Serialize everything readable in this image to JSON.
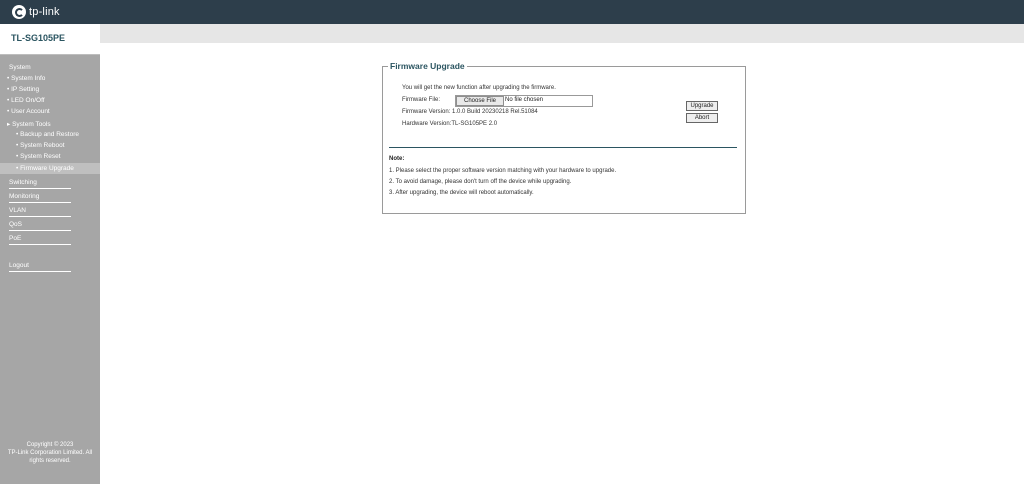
{
  "brand": {
    "logo_text": "tp-link"
  },
  "model": "TL-SG105PE",
  "sidebar": {
    "sections": [
      {
        "label": "System",
        "items": [
          {
            "label": "• System Info"
          },
          {
            "label": "• IP Setting"
          },
          {
            "label": "• LED On/Off"
          },
          {
            "label": "• User Account"
          },
          {
            "label": "▸ System Tools",
            "subitems": [
              {
                "label": "• Backup and Restore"
              },
              {
                "label": "• System Reboot"
              },
              {
                "label": "• System Reset"
              },
              {
                "label": "• Firmware Upgrade",
                "active": true
              }
            ]
          }
        ]
      },
      {
        "label": "Switching"
      },
      {
        "label": "Monitoring"
      },
      {
        "label": "VLAN"
      },
      {
        "label": "QoS"
      },
      {
        "label": "PoE"
      },
      {
        "label": "Logout"
      }
    ],
    "copyright": [
      "Copyright © 2023",
      "TP-Link Corporation Limited. All",
      "rights reserved."
    ]
  },
  "firmware": {
    "title": "Firmware Upgrade",
    "intro": "You will get the new function after upgrading the firmware.",
    "file_label": "Firmware File:",
    "choose_file_label": "Choose File",
    "no_file_text": "No file chosen",
    "firmware_version": "Firmware Version: 1.0.0 Build 20230218 Rel.51084",
    "hardware_version": "Hardware Version:TL-SG105PE 2.0",
    "upgrade_label": "Upgrade",
    "abort_label": "Abort",
    "note_title": "Note:",
    "notes": [
      "1. Please select the proper software version matching with your hardware to upgrade.",
      "2. To avoid damage, please don't turn off the device while upgrading.",
      "3. After upgrading, the device will reboot automatically."
    ]
  }
}
